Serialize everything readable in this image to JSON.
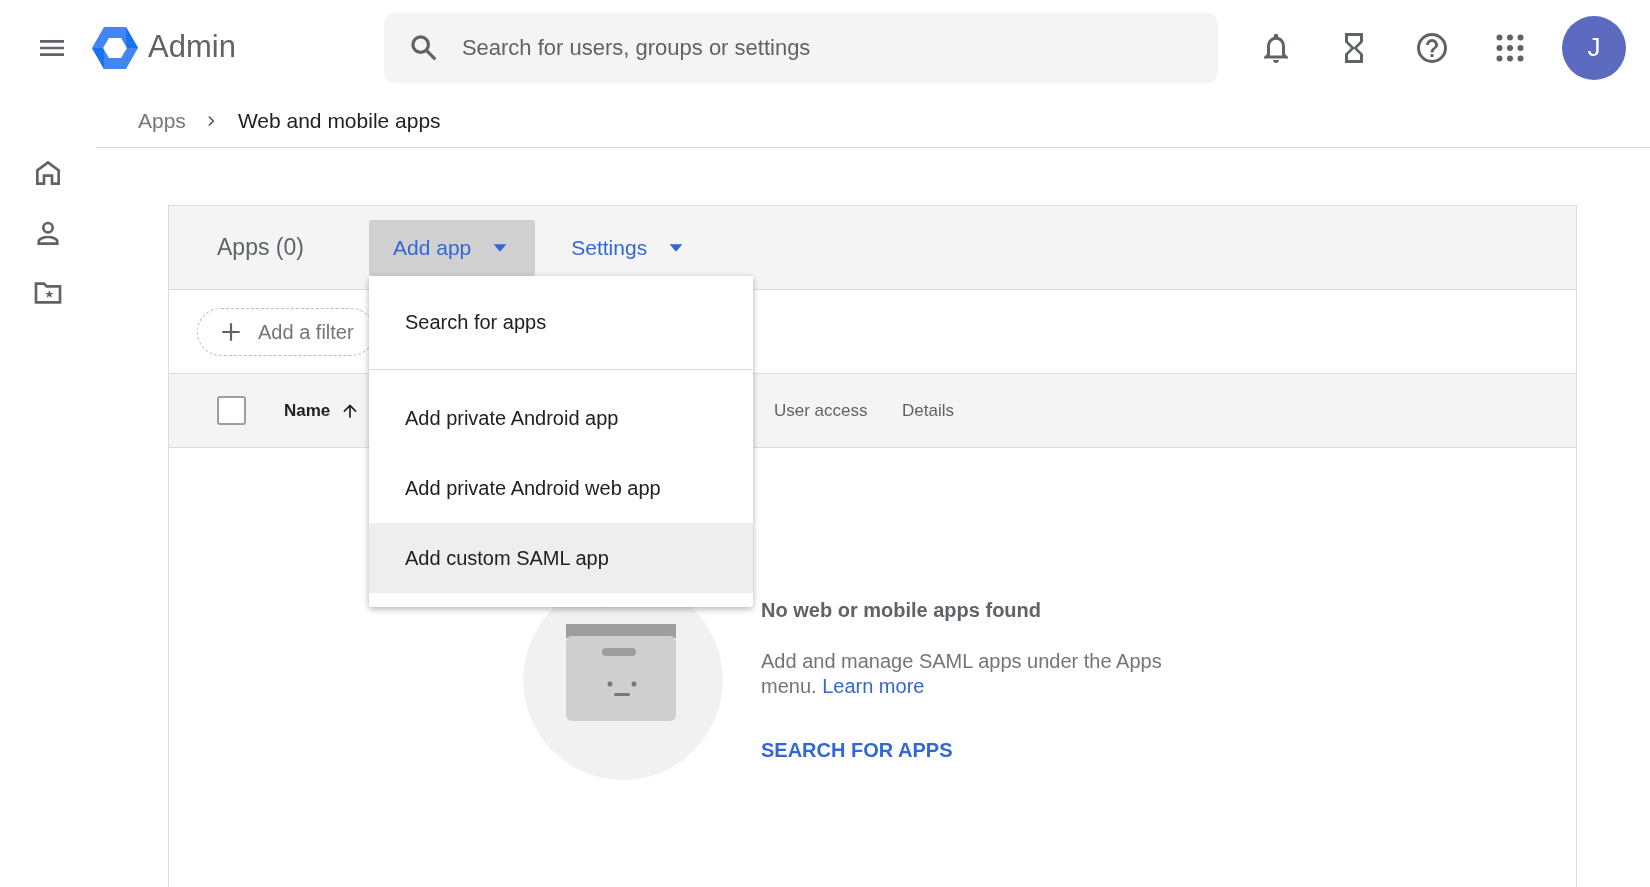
{
  "header": {
    "logo_text": "Admin",
    "search": {
      "placeholder": "Search for users, groups or settings"
    },
    "avatar": "J"
  },
  "breadcrumb": [
    {
      "label": "Apps",
      "current": false
    },
    {
      "label": "Web and mobile apps",
      "current": true
    }
  ],
  "card": {
    "title": "Apps (0)",
    "toolbar": [
      {
        "label": "Add app",
        "expanded": true
      },
      {
        "label": "Settings",
        "expanded": false
      }
    ],
    "filter": {
      "label": "Add a filter"
    },
    "table": {
      "select_all_checked": false,
      "columns": [
        {
          "label": "Name",
          "sorted": true
        },
        {
          "label": "User access",
          "sorted": false
        },
        {
          "label": "Details",
          "sorted": false
        }
      ]
    },
    "empty_state": {
      "title": "No web or mobile apps found",
      "description": "Add and manage SAML apps under the Apps menu.",
      "link": "Learn more",
      "action": "SEARCH FOR APPS"
    }
  },
  "dropdown": {
    "items": [
      {
        "label": "Search for apps",
        "selected": false,
        "divider_after": true
      },
      {
        "label": "Add private Android app",
        "selected": false,
        "divider_after": false
      },
      {
        "label": "Add private Android web app",
        "selected": false,
        "divider_after": false
      },
      {
        "label": "Add custom SAML app",
        "selected": true,
        "divider_after": false
      }
    ]
  }
}
